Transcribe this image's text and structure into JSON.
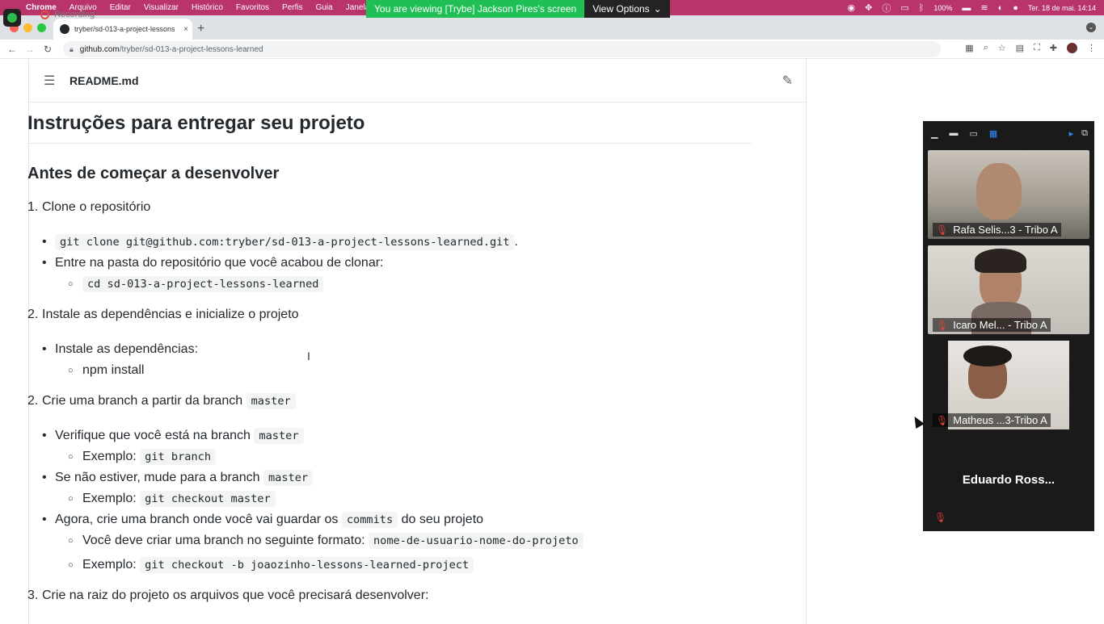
{
  "menubar": {
    "app": "Chrome",
    "items": [
      "Arquivo",
      "Editar",
      "Visualizar",
      "Histórico",
      "Favoritos",
      "Perfis",
      "Guia",
      "Janela"
    ],
    "battery": "100%",
    "datetime": "Ter. 18 de mai. 14:14"
  },
  "share_banner": {
    "message": "You are viewing [Trybe] Jackson Pires's screen",
    "view_options": "View Options"
  },
  "recording": {
    "label": "Recording"
  },
  "browser": {
    "tab_title": "tryber/sd-013-a-project-lessons",
    "tab_close": "×",
    "new_tab": "+",
    "url_host": "github.com",
    "url_path": "/tryber/sd-013-a-project-lessons-learned"
  },
  "readme": {
    "filename": "README.md",
    "h1": "Instruções para entregar seu projeto",
    "h2": "Antes de começar a desenvolver",
    "step1": {
      "n": "1.",
      "text": "Clone o repositório"
    },
    "clone_code": "git clone git@github.com:tryber/sd-013-a-project-lessons-learned.git",
    "clone_tail": ".",
    "enter_folder": "Entre na pasta do repositório que você acabou de clonar:",
    "cd_code": "cd sd-013-a-project-lessons-learned",
    "step2a": {
      "n": "2.",
      "text": "Instale as dependências e inicialize o projeto"
    },
    "install_deps": "Instale as dependências:",
    "npm_install": "npm install",
    "step2b": {
      "n": "2.",
      "text": "Crie uma branch a partir da branch"
    },
    "master": "master",
    "verify": "Verifique que você está na branch",
    "example": "Exemplo:",
    "git_branch": "git branch",
    "if_not": "Se não estiver, mude para a branch",
    "git_checkout_master": "git checkout master",
    "now_create": "Agora, crie uma branch onde você vai guardar os",
    "commits": "commits",
    "of_project": "do seu projeto",
    "format_text": "Você deve criar uma branch no seguinte formato:",
    "format_code": "nome-de-usuario-nome-do-projeto",
    "checkout_b": "git checkout -b joaozinho-lessons-learned-project",
    "step3": {
      "n": "3.",
      "text": "Crie na raiz do projeto os arquivos que você precisará desenvolver:"
    }
  },
  "gallery": {
    "participants": [
      {
        "name": "Rafa Selis...3 - Tribo A",
        "muted": true
      },
      {
        "name": "Icaro Mel... - Tribo A",
        "muted": true
      },
      {
        "name": "Matheus ...3-Tribo A",
        "muted": true
      },
      {
        "name": "Eduardo  Ross...",
        "muted": true
      }
    ]
  },
  "colors": {
    "menubar": "#b8346a",
    "banner": "#20bf55",
    "mute": "#e0413e"
  }
}
